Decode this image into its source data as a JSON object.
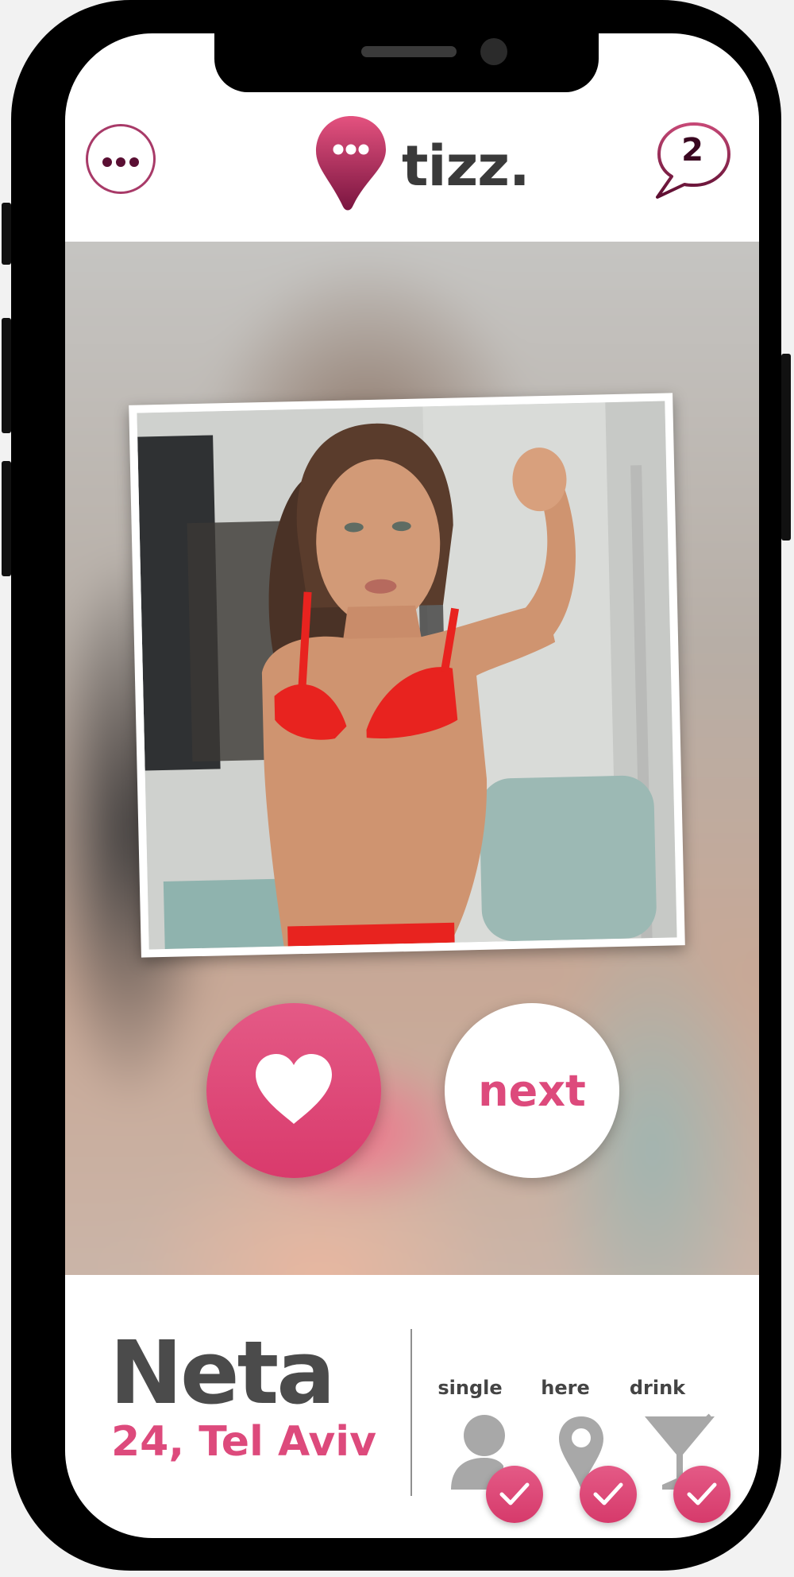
{
  "app": {
    "logo_text": "tizz.",
    "menu_icon": "more-horizontal-icon",
    "chat_count": "2",
    "brand_color": "#dd4a7c"
  },
  "actions": {
    "like_icon": "heart-icon",
    "next_label": "next"
  },
  "profile": {
    "name": "Neta",
    "details": "24, Tel Aviv",
    "statuses": [
      {
        "label": "single",
        "icon": "person-icon",
        "checked": true
      },
      {
        "label": "here",
        "icon": "location-pin-icon",
        "checked": true
      },
      {
        "label": "drink",
        "icon": "cocktail-glass-icon",
        "checked": true
      }
    ]
  }
}
